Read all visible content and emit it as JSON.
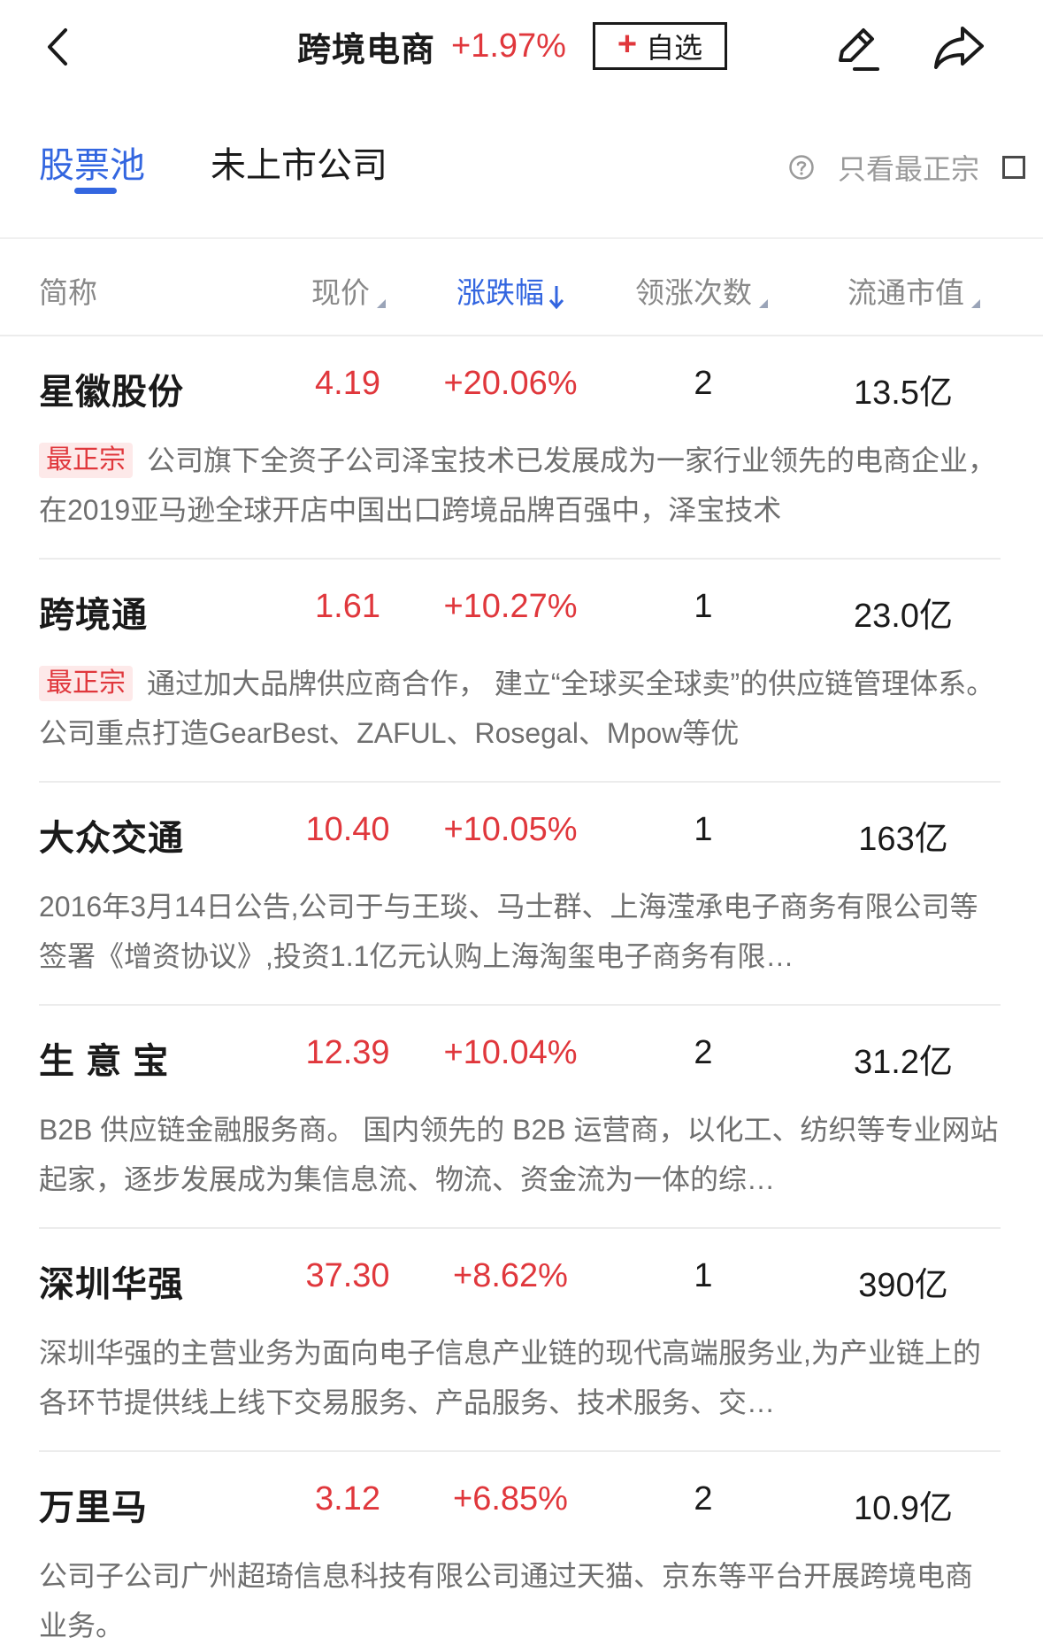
{
  "header": {
    "title": "跨境电商",
    "change_pct": "+1.97%",
    "fav_plus": "+",
    "fav_label": "自选"
  },
  "tabs": [
    {
      "label": "股票池",
      "active": true
    },
    {
      "label": "未上市公司",
      "active": false
    }
  ],
  "filter": {
    "label": "只看最正宗"
  },
  "columns": {
    "name": "简称",
    "price": "现价",
    "change": "涨跌幅",
    "lead": "领涨次数",
    "cap": "流通市值"
  },
  "colors": {
    "accent": "#3366e0",
    "up": "#e0373c",
    "badge_bg": "#fde9e9"
  },
  "stocks": [
    {
      "name": "星徽股份",
      "price": "4.19",
      "change": "+20.06%",
      "lead": "2",
      "cap": "13.5亿",
      "badge": "最正宗",
      "desc": "公司旗下全资子公司泽宝技术已发展成为一家行业领先的电商企业，在2019亚马逊全球开店中国出口跨境品牌百强中，泽宝技术"
    },
    {
      "name": "跨境通",
      "price": "1.61",
      "change": "+10.27%",
      "lead": "1",
      "cap": "23.0亿",
      "badge": "最正宗",
      "desc": "通过加大品牌供应商合作， 建立“全球买全球卖”的供应链管理体系。公司重点打造GearBest、ZAFUL、Rosegal、Mpow等优"
    },
    {
      "name": "大众交通",
      "price": "10.40",
      "change": "+10.05%",
      "lead": "1",
      "cap": "163亿",
      "badge": "",
      "desc": "2016年3月14日公告,公司于与王琰、马士群、上海滢承电子商务有限公司等签署《增资协议》,投资1.1亿元认购上海淘玺电子商务有限…"
    },
    {
      "name": "生 意 宝",
      "price": "12.39",
      "change": "+10.04%",
      "lead": "2",
      "cap": "31.2亿",
      "badge": "",
      "desc": "B2B 供应链金融服务商。 国内领先的 B2B 运营商，以化工、纺织等专业网站起家，逐步发展成为集信息流、物流、资金流为一体的综…"
    },
    {
      "name": "深圳华强",
      "price": "37.30",
      "change": "+8.62%",
      "lead": "1",
      "cap": "390亿",
      "badge": "",
      "desc": "深圳华强的主营业务为面向电子信息产业链的现代高端服务业,为产业链上的各环节提供线上线下交易服务、产品服务、技术服务、交…"
    },
    {
      "name": "万里马",
      "price": "3.12",
      "change": "+6.85%",
      "lead": "2",
      "cap": "10.9亿",
      "badge": "",
      "desc": "公司子公司广州超琦信息科技有限公司通过天猫、京东等平台开展跨境电商业务。"
    }
  ]
}
